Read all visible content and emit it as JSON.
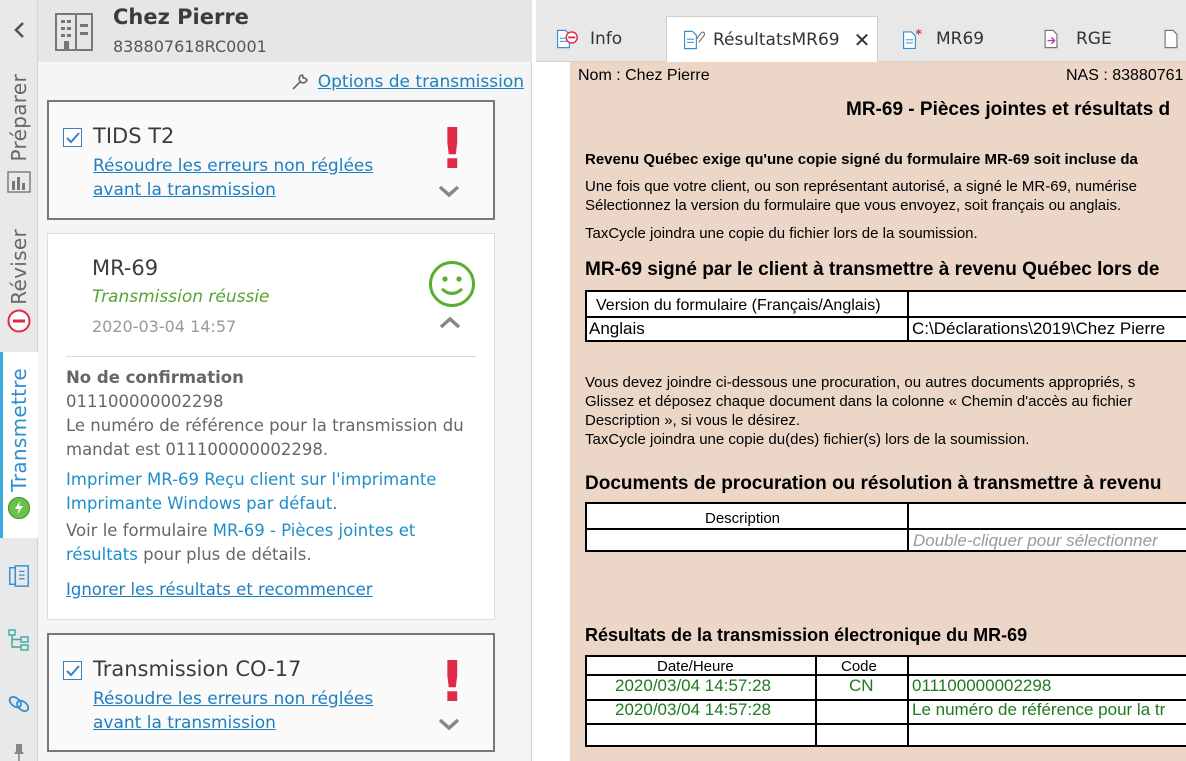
{
  "nav": {
    "back_icon": "chevron-left-icon",
    "tabs": [
      {
        "label": "Préparer"
      },
      {
        "label": "Réviser"
      },
      {
        "label": "Transmettre"
      }
    ]
  },
  "client": {
    "name": "Chez Pierre",
    "id": "838807618RC0001"
  },
  "options_link": "Options de transmission",
  "cards": {
    "tids": {
      "title": "TIDS T2",
      "error_link": "Résoudre les erreurs non réglées avant la transmission"
    },
    "mr69": {
      "title": "MR-69",
      "status": "Transmission réussie",
      "date": "2020-03-04 14:57",
      "confirmation_label": "No de confirmation",
      "confirmation_number": "011100000002298",
      "reference_text": "Le numéro de référence pour la transmission du mandat est 011100000002298.",
      "print_link": "Imprimer MR-69 Reçu client sur l'imprimante Imprimante Windows par défaut",
      "print_period": ".",
      "view_prefix": "Voir le formulaire ",
      "view_link": "MR-69 - Pièces jointes et résultats",
      "view_suffix": " pour plus de détails.",
      "ignore_link": "Ignorer les résultats et recommencer"
    },
    "co17": {
      "title": "Transmission CO-17",
      "error_link": "Résoudre les erreurs non réglées avant la transmission"
    }
  },
  "doc_tabs": [
    {
      "label": "Info",
      "icon": "doc-error-icon"
    },
    {
      "label": "RésultatsMR69",
      "icon": "doc-clip-icon",
      "active": true
    },
    {
      "label": "MR69",
      "icon": "doc-star-icon"
    },
    {
      "label": "RGE",
      "icon": "doc-arrow-icon"
    }
  ],
  "doc": {
    "name_line": "Nom : Chez Pierre",
    "nas_line": "NAS : 83880761",
    "title": "MR-69 - Pièces jointes et résultats d",
    "p1_bold": "Revenu Québec exige qu'une copie signé du formulaire MR-69 soit incluse da",
    "p1_l2": "Une fois que votre client, ou son représentant autorisé, a signé le MR-69, numérise",
    "p1_l3": "Sélectionnez la version du formulaire que vous envoyez, soit français ou anglais.",
    "p1_l4": "TaxCycle joindra une copie du fichier lors de la soumission.",
    "h2": "MR-69 signé par le client à transmettre à revenu Québec lors de",
    "t1_header_version": "Version du formulaire (Français/Anglais)",
    "t1_value_version": "Anglais",
    "t1_value_path": "C:\\Déclarations\\2019\\Chez Pierre",
    "p2_l1": "Vous devez joindre ci-dessous une procuration, ou autres documents appropriés, s",
    "p2_l2": "Glissez et déposez chaque document dans la colonne « Chemin d'accès au fichier",
    "p2_l3": "Description », si vous le désirez.",
    "p2_l4": "TaxCycle joindra une copie du(des) fichier(s) lors de la soumission.",
    "h3": "Documents de procuration ou résolution à transmettre à revenu",
    "t2_header_desc": "Description",
    "t2_placeholder": "Double-cliquer pour sélectionner",
    "h4": "Résultats de la transmission électronique du MR-69",
    "t3_headers": {
      "date": "Date/Heure",
      "code": "Code"
    },
    "t3_rows": [
      {
        "date": "2020/03/04 14:57:28",
        "code": "CN",
        "message": "011100000002298"
      },
      {
        "date": "2020/03/04 14:57:28",
        "code": "",
        "message": "Le numéro de référence pour la tr"
      }
    ]
  }
}
